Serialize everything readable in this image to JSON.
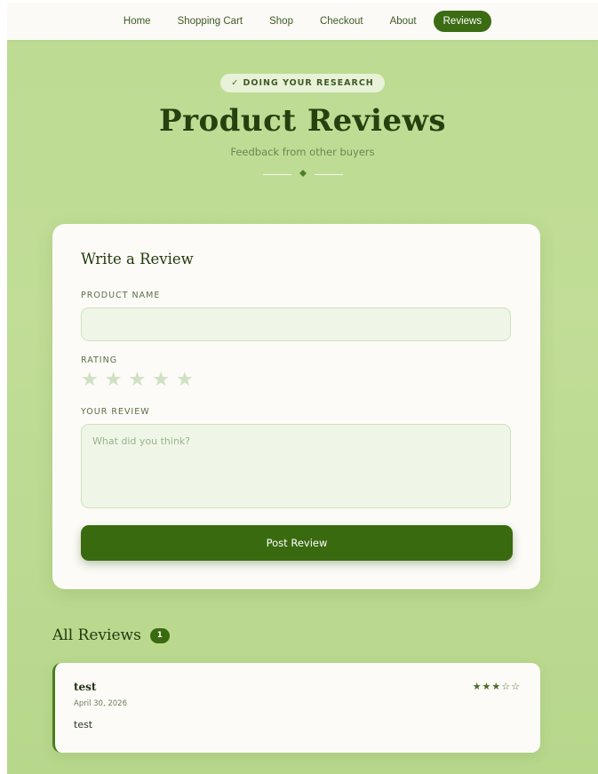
{
  "nav": {
    "items": [
      {
        "label": "Home"
      },
      {
        "label": "Shopping Cart"
      },
      {
        "label": "Shop"
      },
      {
        "label": "Checkout"
      },
      {
        "label": "About"
      },
      {
        "label": "Reviews",
        "active": true
      }
    ]
  },
  "hero": {
    "badge": "✓ DOING YOUR RESEARCH",
    "title": "Product Reviews",
    "subtitle": "Feedback from other buyers",
    "divider_icon": "leaf-icon"
  },
  "form": {
    "title": "Write a Review",
    "product_label": "PRODUCT NAME",
    "product_value": "",
    "rating_label": "RATING",
    "rating_value": 0,
    "rating_max": 5,
    "review_label": "YOUR REVIEW",
    "review_placeholder": "What did you think?",
    "submit_label": "Post Review"
  },
  "reviews": {
    "heading": "All Reviews",
    "count": "1",
    "items": [
      {
        "name": "test",
        "date": "April 30, 2026",
        "text": "test",
        "rating": 3,
        "rating_max": 5,
        "stars": "★★★☆☆"
      }
    ]
  },
  "colors": {
    "accent": "#3a6a0f",
    "background": "#bfdc94",
    "card": "#fcfbf7"
  }
}
